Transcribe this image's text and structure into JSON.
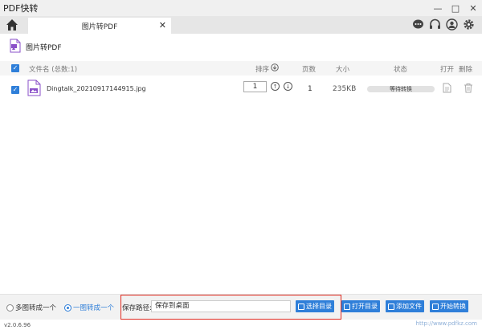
{
  "app": {
    "title": "PDF快转"
  },
  "window_controls": {
    "minimize": "—",
    "maximize": "□",
    "close": "✕"
  },
  "tab": {
    "label": "图片转PDF",
    "close": "✕"
  },
  "section": {
    "title": "图片转PDF"
  },
  "table": {
    "headers": {
      "filename": "文件名 (总数:1)",
      "order": "排序",
      "pages": "页数",
      "size": "大小",
      "status": "状态",
      "open": "打开",
      "delete": "删除"
    },
    "rows": [
      {
        "filename": "Dingtalk_20210917144915.jpg",
        "order": "1",
        "pages": "1",
        "size": "235KB",
        "status": "等待转换"
      }
    ]
  },
  "bottom": {
    "mode_multi": "多图转成一个",
    "mode_single": "一图转成一个",
    "path_label": "保存路径:",
    "path_value": "保存到桌面",
    "choose_dir": "选择目录",
    "open_dir": "打开目录",
    "add_file": "添加文件",
    "start": "开始转换"
  },
  "version": "v2.0.6.96",
  "watermark": "http://www.pdfkz.com",
  "colors": {
    "accent": "#2f7fd9",
    "highlight": "#e0291f",
    "pdf_purple": "#8a4fc8"
  }
}
